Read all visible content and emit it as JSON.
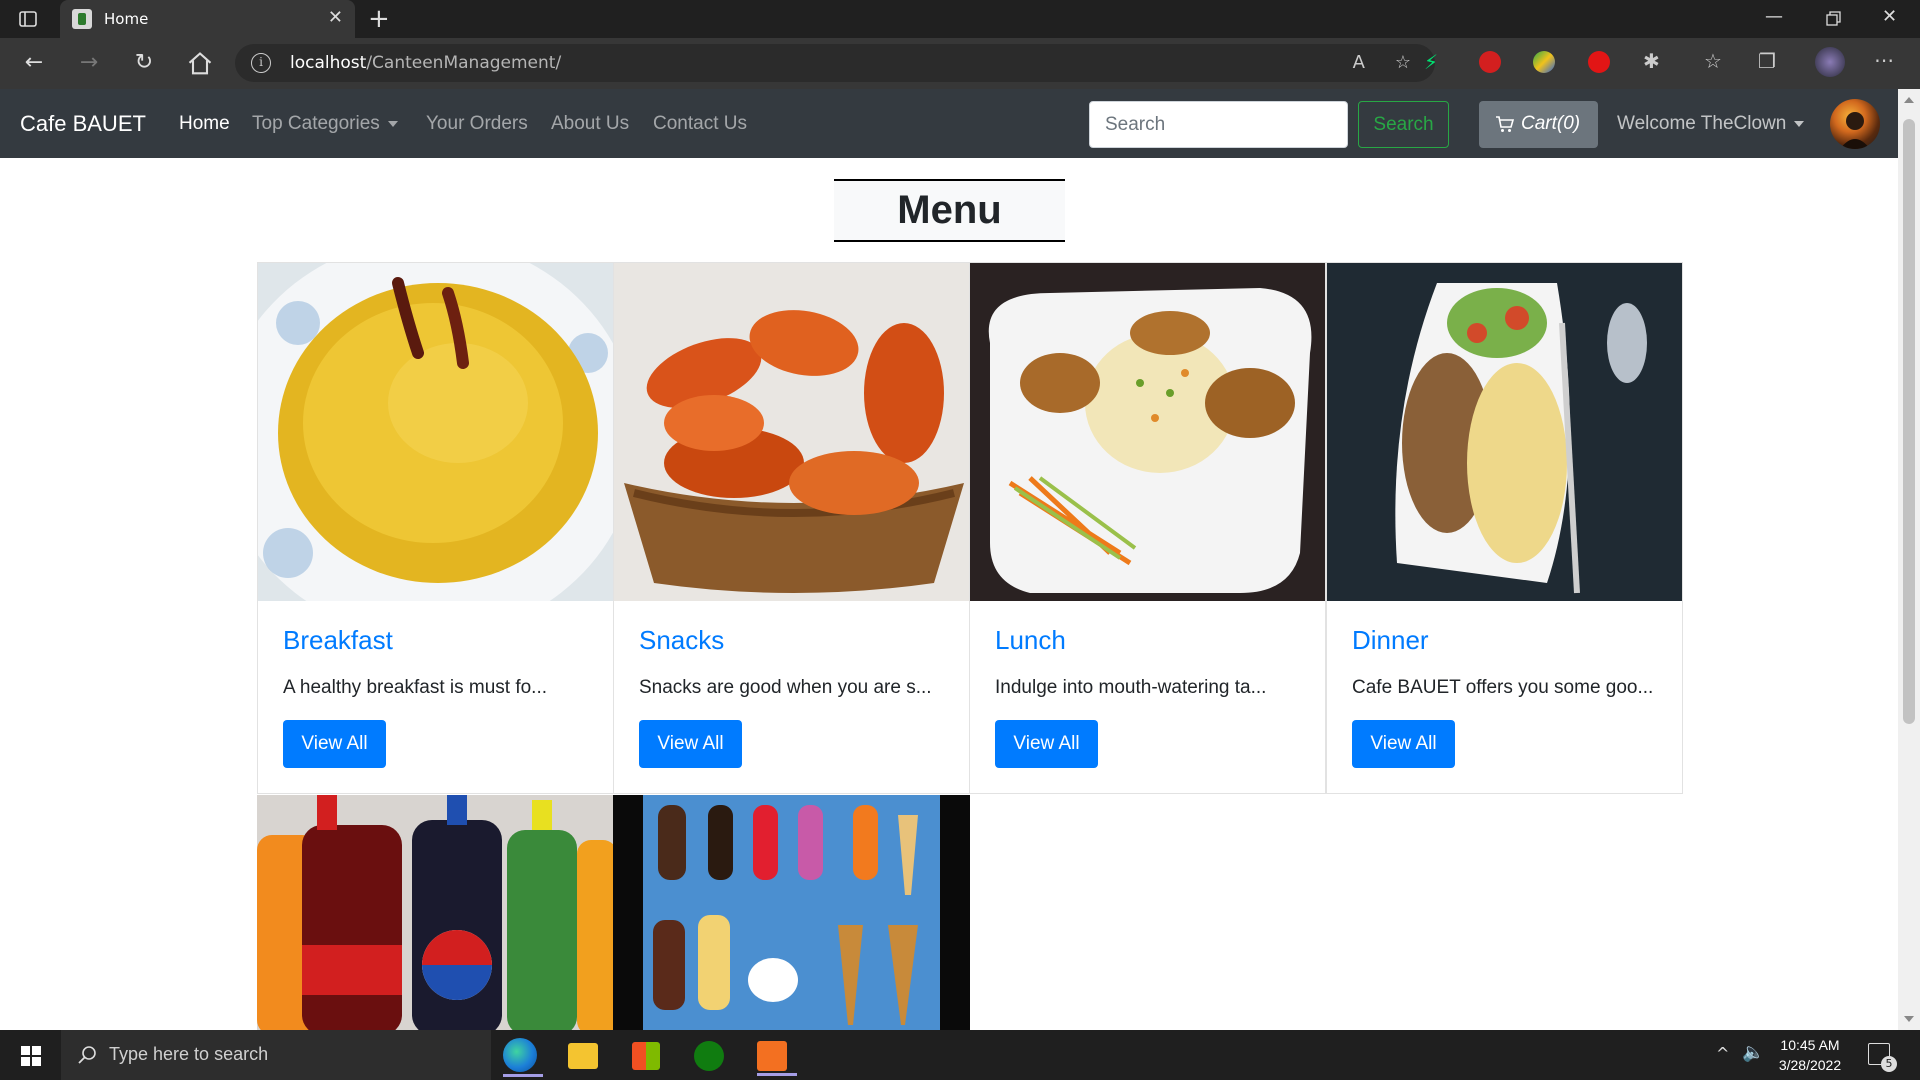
{
  "browser": {
    "tab_title": "Home",
    "url_host": "localhost",
    "url_path": "/CanteenManagement/"
  },
  "navbar": {
    "brand": "Cafe BAUET",
    "links": [
      "Home",
      "Top Categories",
      "Your Orders",
      "About Us",
      "Contact Us"
    ],
    "search_placeholder": "Search",
    "search_button": "Search",
    "cart_label": "Cart(0)",
    "welcome": "Welcome TheClown"
  },
  "page": {
    "heading": "Menu",
    "categories": [
      {
        "title": "Breakfast",
        "text": "A healthy breakfast is must fo...",
        "button": "View All",
        "image": "yellow-rice-image"
      },
      {
        "title": "Snacks",
        "text": "Snacks are good when you are s...",
        "button": "View All",
        "image": "fried-snacks-image"
      },
      {
        "title": "Lunch",
        "text": "Indulge into mouth-watering ta...",
        "button": "View All",
        "image": "fried-rice-image"
      },
      {
        "title": "Dinner",
        "text": "Cafe BAUET offers you some goo...",
        "button": "View All",
        "image": "rice-chicken-image"
      }
    ],
    "second_row_images": [
      "soft-drinks-image",
      "ice-cream-image"
    ]
  },
  "taskbar": {
    "search_text": "Type here to search",
    "time": "10:45 AM",
    "date": "3/28/2022",
    "notification_count": "5"
  },
  "colors": {
    "navbar_bg": "#343a40",
    "primary": "#007bff",
    "success": "#28a745",
    "secondary": "#6c757d"
  }
}
